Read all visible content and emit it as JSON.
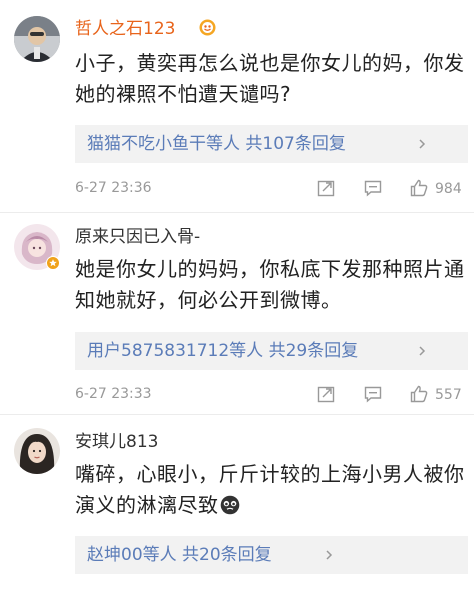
{
  "comments": [
    {
      "user": "哲人之石123",
      "content": "小子，黄奕再怎么说也是你女儿的妈，你发她的裸照不怕遭天谴吗?",
      "replies": "猫猫不吃小鱼干等人 共107条回复",
      "time": "6-27 23:36",
      "likes": "984"
    },
    {
      "user": "原来只因已入骨-",
      "content": "她是你女儿的妈妈，你私底下发那种照片通知她就好，何必公开到微博。",
      "replies": "用户5875831712等人 共29条回复",
      "time": "6-27 23:33",
      "likes": "557"
    },
    {
      "user": "安琪儿813",
      "content": "嘴碎，心眼小，斤斤计较的上海小男人被你演义的淋漓尽致",
      "replies": "赵坤00等人 共20条回复",
      "time": "",
      "likes": ""
    }
  ],
  "icons": {
    "vip_badge": "vip-badge-icon",
    "share": "share-icon",
    "comment": "comment-icon",
    "like": "like-icon",
    "emoji": "crying-emoji-icon",
    "chevron": "chevron-right-icon"
  },
  "colors": {
    "vip_name": "#e8641b",
    "reply_link": "#5b7cb8",
    "reply_bg": "#f2f2f2",
    "meta": "#999999"
  }
}
